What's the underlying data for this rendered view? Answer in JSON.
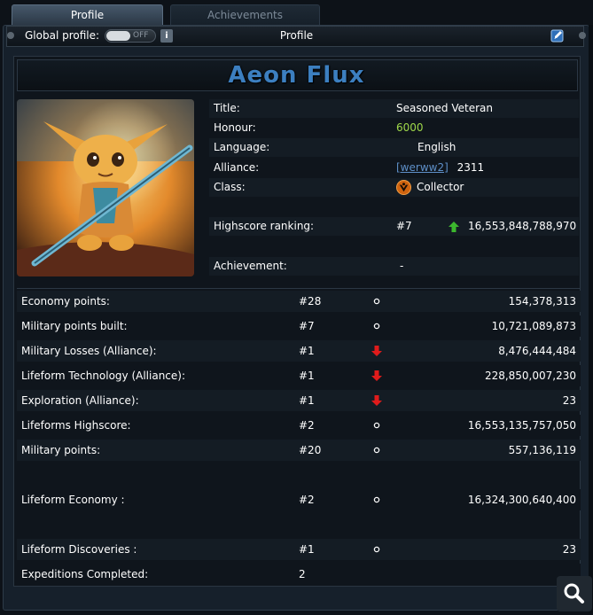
{
  "tabs": {
    "profile": "Profile",
    "achievements": "Achievements"
  },
  "header": {
    "global_profile_label": "Global profile:",
    "toggle_state": "OFF",
    "info_glyph": "i",
    "title": "Profile",
    "edit_icon": "edit-icon"
  },
  "player": {
    "name": "Aeon Flux",
    "avatar_icon": "fox-creature-avatar"
  },
  "info": {
    "title_label": "Title:",
    "title_value": "Seasoned Veteran",
    "honour_label": "Honour:",
    "honour_value": "6000",
    "language_label": "Language:",
    "language_value": "English",
    "alliance_label": "Alliance:",
    "alliance_tag": "[werww2]",
    "alliance_number": "2311",
    "class_label": "Class:",
    "class_value": "Collector",
    "highscore_label": "Highscore ranking:",
    "highscore_rank": "#7",
    "highscore_points": "16,553,848,788,970",
    "achievement_label": "Achievement:",
    "achievement_value": "-"
  },
  "stats": [
    {
      "name": "Economy points:",
      "rank": "#28",
      "trend": "neutral",
      "value": "154,378,313"
    },
    {
      "name": "Military points built:",
      "rank": "#7",
      "trend": "neutral",
      "value": "10,721,089,873"
    },
    {
      "name": "Military Losses (Alliance):",
      "rank": "#1",
      "trend": "down",
      "value": "8,476,444,484"
    },
    {
      "name": "Lifeform Technology (Alliance):",
      "rank": "#1",
      "trend": "down",
      "value": "228,850,007,230"
    },
    {
      "name": "Exploration (Alliance):",
      "rank": "#1",
      "trend": "down",
      "value": "23"
    },
    {
      "name": "Lifeforms Highscore:",
      "rank": "#2",
      "trend": "neutral",
      "value": "16,553,135,757,050"
    },
    {
      "name": "Military points:",
      "rank": "#20",
      "trend": "neutral",
      "value": "557,136,119"
    },
    {
      "name": "Lifeform Economy :",
      "rank": "#2",
      "trend": "neutral",
      "value": "16,324,300,640,400"
    },
    {
      "name": "Lifeform Discoveries :",
      "rank": "#1",
      "trend": "neutral",
      "value": "23"
    },
    {
      "name": "Expeditions Completed:",
      "rank": "2",
      "trend": "none",
      "value": ""
    }
  ],
  "colors": {
    "name_blue": "#3c7fc0",
    "honour_green": "#9fd84a",
    "trend_up_green": "#3cb82e",
    "trend_down_red": "#e01b1b",
    "link_blue": "#5e8fc8"
  }
}
